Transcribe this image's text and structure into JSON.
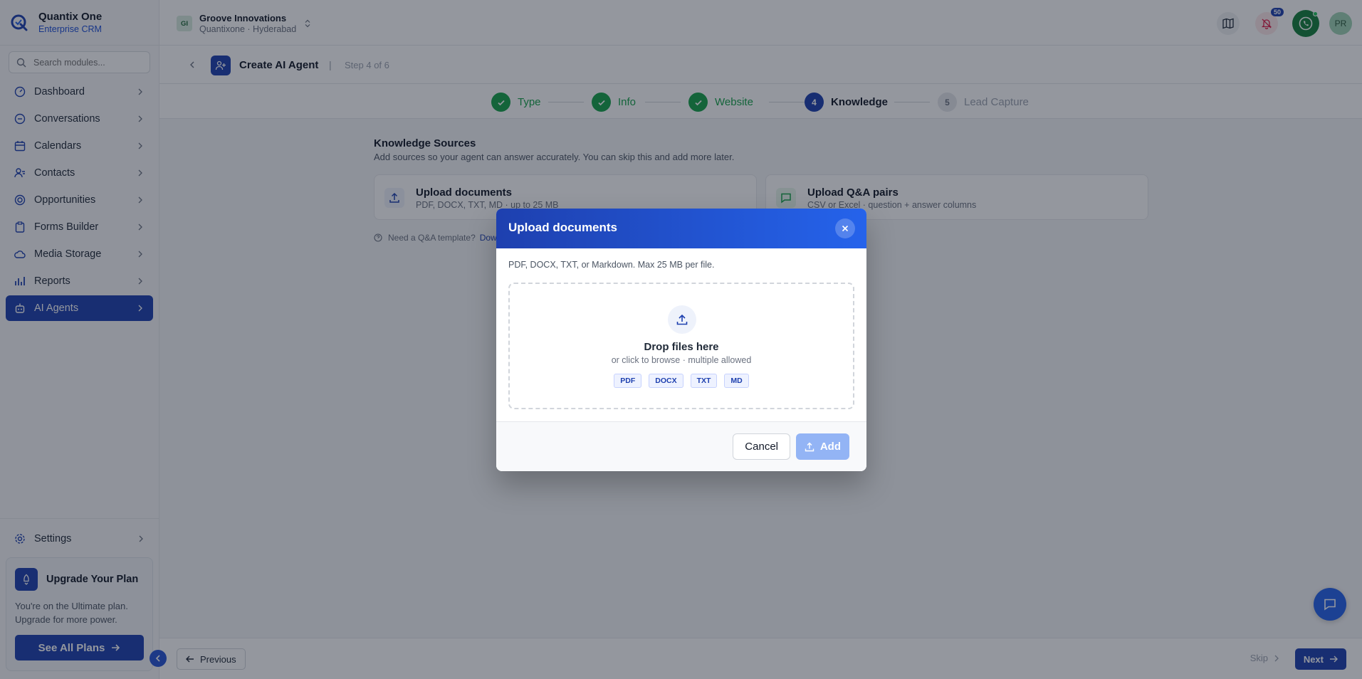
{
  "brand": {
    "name": "Quantix One",
    "subtitle": "Enterprise CRM"
  },
  "search": {
    "placeholder": "Search modules..."
  },
  "sidebar": {
    "items": [
      {
        "label": "Dashboard",
        "icon": "dashboard-icon"
      },
      {
        "label": "Conversations",
        "icon": "chat-icon"
      },
      {
        "label": "Calendars",
        "icon": "calendar-icon"
      },
      {
        "label": "Contacts",
        "icon": "contacts-icon"
      },
      {
        "label": "Opportunities",
        "icon": "target-icon"
      },
      {
        "label": "Forms Builder",
        "icon": "clipboard-icon"
      },
      {
        "label": "Media Storage",
        "icon": "cloud-icon"
      },
      {
        "label": "Reports",
        "icon": "bar-chart-icon"
      },
      {
        "label": "AI Agents",
        "icon": "bot-icon",
        "active": true
      }
    ],
    "settings_label": "Settings"
  },
  "upgrade": {
    "title": "Upgrade Your Plan",
    "text": "You're on the Ultimate plan. Upgrade for more power.",
    "button": "See All Plans"
  },
  "header": {
    "org_initials": "GI",
    "org_name": "Groove Innovations",
    "org_location": "Quantixone · Hyderabad",
    "notification_count": "50",
    "avatar_initials": "PR"
  },
  "page": {
    "title": "Create AI Agent",
    "step_indicator": "Step 4 of 6"
  },
  "stepper": {
    "steps": [
      {
        "num": "",
        "label": "Type",
        "state": "done"
      },
      {
        "num": "",
        "label": "Info",
        "state": "done"
      },
      {
        "num": "",
        "label": "Website",
        "state": "done"
      },
      {
        "num": "4",
        "label": "Knowledge",
        "state": "current"
      },
      {
        "num": "5",
        "label": "Lead Capture",
        "state": "todo"
      }
    ]
  },
  "knowledge": {
    "title": "Knowledge Sources",
    "subtitle": "Add sources so your agent can answer accurately. You can skip this and add more later.",
    "cards": [
      {
        "title": "Upload documents",
        "subtitle": "PDF, DOCX, TXT, MD · up to 25 MB"
      },
      {
        "title": "Upload Q&A pairs",
        "subtitle": "CSV or Excel · question + answer columns"
      }
    ],
    "hint": "Need a Q&A template?",
    "hint_link": "Dow"
  },
  "footer": {
    "previous": "Previous",
    "skip": "Skip",
    "next": "Next"
  },
  "modal": {
    "title": "Upload documents",
    "description": "PDF, DOCX, TXT, or Markdown. Max 25 MB per file.",
    "drop_title": "Drop files here",
    "drop_subtitle": "or click to browse · multiple allowed",
    "file_types": [
      "PDF",
      "DOCX",
      "TXT",
      "MD"
    ],
    "cancel": "Cancel",
    "add": "Add"
  },
  "colors": {
    "primary": "#1e40af",
    "success": "#16a34a",
    "add_disabled": "#93b4f5"
  }
}
